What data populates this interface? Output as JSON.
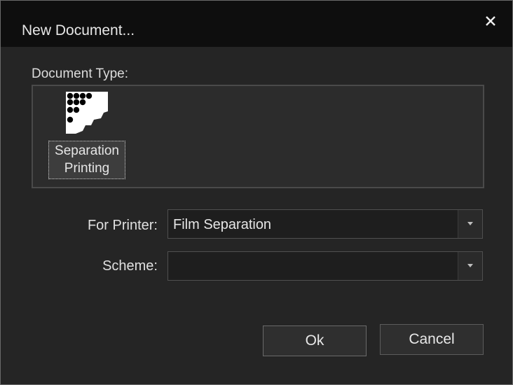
{
  "dialog": {
    "title": "New Document...",
    "close_icon": "close-icon"
  },
  "document_type": {
    "label": "Document Type:",
    "items": [
      {
        "label_line1": "Separation",
        "label_line2": "Printing",
        "icon": "separation-printing-icon",
        "selected": true
      }
    ]
  },
  "printer": {
    "label": "For Printer:",
    "value": "Film Separation"
  },
  "scheme": {
    "label": "Scheme:",
    "value": ""
  },
  "buttons": {
    "ok": "Ok",
    "cancel": "Cancel"
  },
  "colors": {
    "titlebar": "#0e0e0e",
    "background": "#252525",
    "text": "#e6e6e6"
  }
}
